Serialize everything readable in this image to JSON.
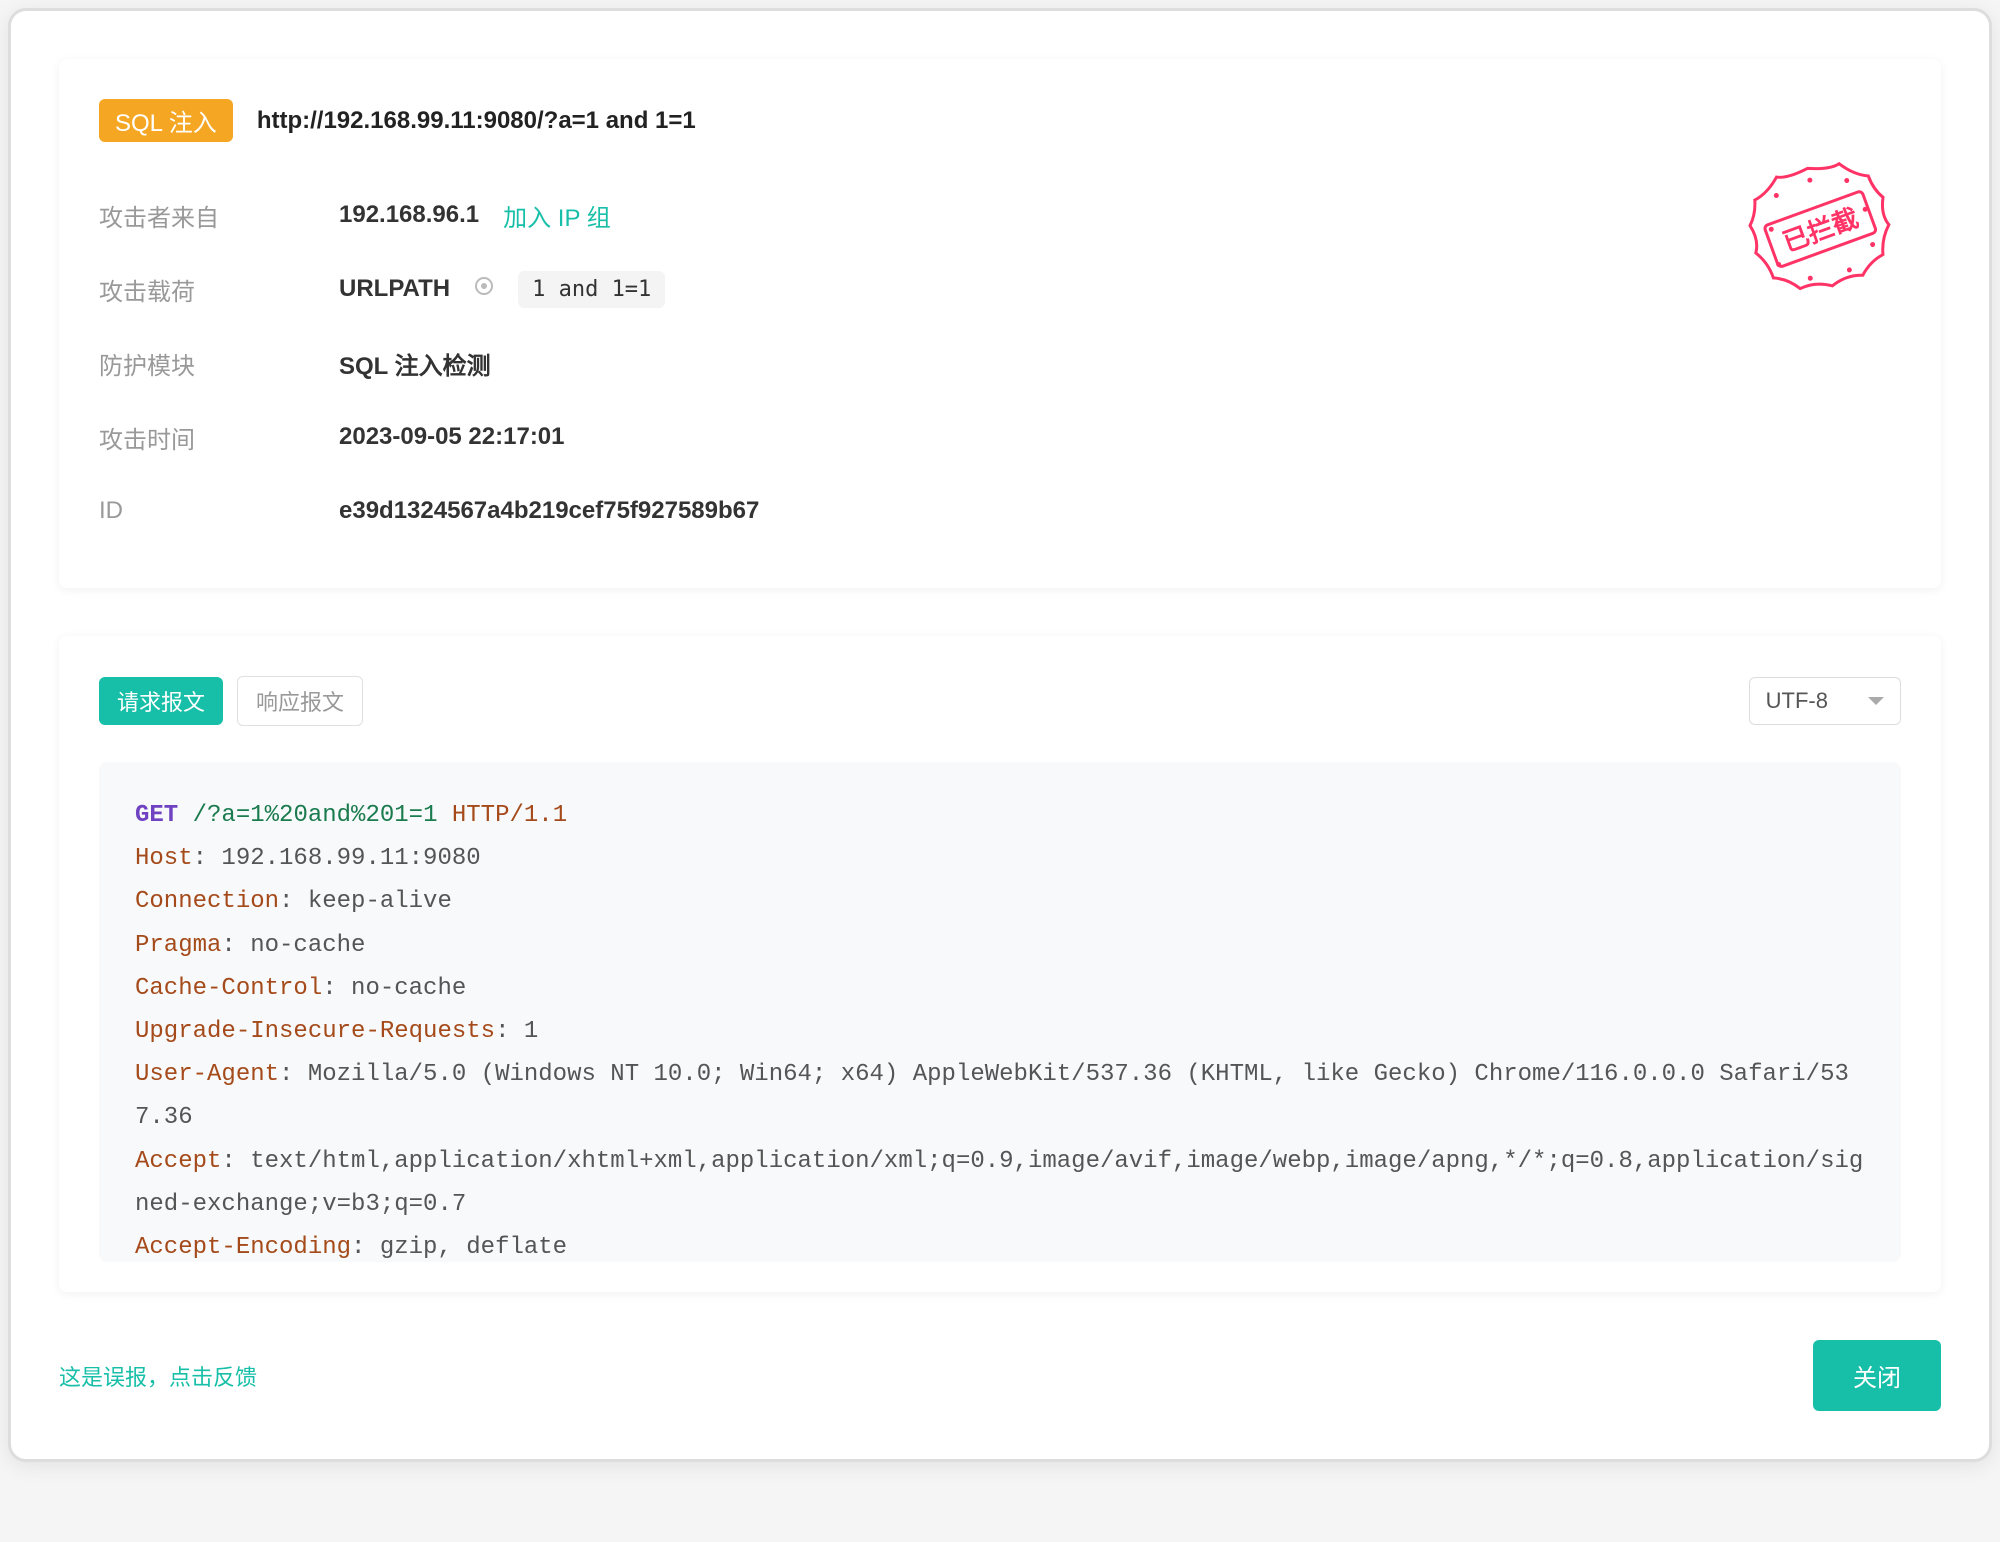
{
  "header": {
    "tag": "SQL 注入",
    "url": "http://192.168.99.11:9080/?a=1 and 1=1"
  },
  "stamp_text": "已拦截",
  "info": {
    "attacker_from_label": "攻击者来自",
    "attacker_ip": "192.168.96.1",
    "add_ip_group": "加入 IP 组",
    "payload_label": "攻击载荷",
    "payload_location": "URLPATH",
    "payload_code": "1 and 1=1",
    "module_label": "防护模块",
    "module_value": "SQL 注入检测",
    "time_label": "攻击时间",
    "time_value": "2023-09-05 22:17:01",
    "id_label": "ID",
    "id_value": "e39d1324567a4b219cef75f927589b67"
  },
  "tabs": {
    "request": "请求报文",
    "response": "响应报文"
  },
  "encoding": "UTF-8",
  "request": {
    "method": "GET",
    "path": "/?a=1%20and%201=1",
    "protocol": "HTTP/1.1",
    "headers": [
      {
        "k": "Host",
        "v": "192.168.99.11:9080"
      },
      {
        "k": "Connection",
        "v": "keep-alive"
      },
      {
        "k": "Pragma",
        "v": "no-cache"
      },
      {
        "k": "Cache-Control",
        "v": "no-cache"
      },
      {
        "k": "Upgrade-Insecure-Requests",
        "v": "1"
      },
      {
        "k": "User-Agent",
        "v": "Mozilla/5.0 (Windows NT 10.0; Win64; x64) AppleWebKit/537.36 (KHTML, like Gecko) Chrome/116.0.0.0 Safari/537.36"
      },
      {
        "k": "Accept",
        "v": "text/html,application/xhtml+xml,application/xml;q=0.9,image/avif,image/webp,image/apng,*/*;q=0.8,application/signed-exchange;v=b3;q=0.7"
      },
      {
        "k": "Accept-Encoding",
        "v": "gzip, deflate"
      }
    ]
  },
  "footer": {
    "feedback": "这是误报，点击反馈",
    "close": "关闭"
  }
}
